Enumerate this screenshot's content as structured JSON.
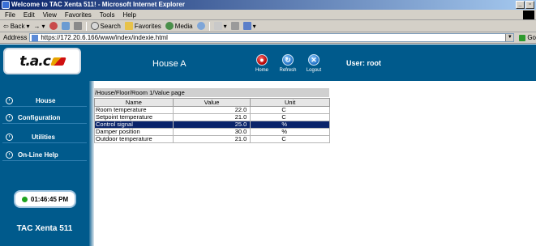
{
  "browser": {
    "title": "Welcome to TAC Xenta 511! - Microsoft Internet Explorer",
    "menu": [
      "File",
      "Edit",
      "View",
      "Favorites",
      "Tools",
      "Help"
    ],
    "toolbar": {
      "back": "Back",
      "search": "Search",
      "favorites": "Favorites",
      "media": "Media"
    },
    "address_label": "Address",
    "url": "https://172.20.6.166/www/index/indexie.html",
    "go": "Go"
  },
  "header": {
    "logo": "t.a.c",
    "title": "House A",
    "home": "Home",
    "refresh": "Refresh",
    "logout": "Logout",
    "user": "User: root"
  },
  "sidebar": {
    "items": [
      {
        "label": "House"
      },
      {
        "label": "Configuration"
      },
      {
        "label": "Utilities"
      },
      {
        "label": "On-Line Help"
      }
    ],
    "clock": "01:46:45 PM",
    "product": "TAC Xenta 511"
  },
  "content": {
    "breadcrumb": "/House/Floor/Room 1/Value page",
    "columns": [
      "Name",
      "Value",
      "Unit"
    ],
    "rows": [
      {
        "name": "Room temperature",
        "value": "22.0",
        "unit": "C"
      },
      {
        "name": "Setpoint temperature",
        "value": "21.0",
        "unit": "C"
      },
      {
        "name": "Control signal",
        "value": "25.0",
        "unit": "%"
      },
      {
        "name": "Damper position",
        "value": "30.0",
        "unit": "%"
      },
      {
        "name": "Outdoor temperature",
        "value": "21.0",
        "unit": "C"
      }
    ],
    "selected_row": 2
  },
  "colors": {
    "brand_blue": "#005a8c",
    "selection": "#0a246a"
  }
}
